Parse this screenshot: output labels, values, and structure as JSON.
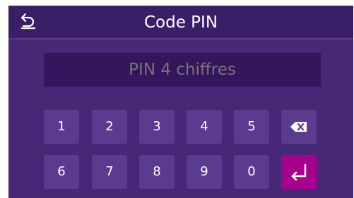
{
  "header": {
    "title": "Code PIN",
    "back_icon": "undo-arrow-icon"
  },
  "pin_input": {
    "placeholder": "PIN 4 chiffres",
    "value": ""
  },
  "keypad": {
    "row1": [
      "1",
      "2",
      "3",
      "4",
      "5"
    ],
    "row2": [
      "6",
      "7",
      "8",
      "9",
      "0"
    ],
    "backspace_icon": "backspace-icon",
    "enter_icon": "enter-icon"
  },
  "colors": {
    "background": "#472876",
    "header": "#3a1e68",
    "field": "#35165c",
    "key": "#5b3b8d",
    "enter_key": "#a6008f"
  }
}
